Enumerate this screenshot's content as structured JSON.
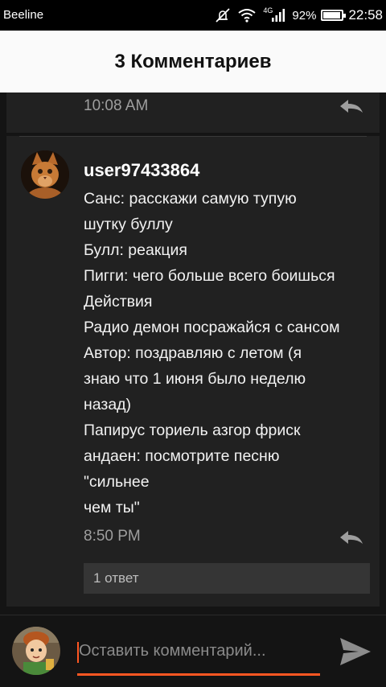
{
  "status_bar": {
    "carrier": "Beeline",
    "network": "4G",
    "battery": "92%",
    "battery_level": 0.92,
    "time": "22:58"
  },
  "header": {
    "title": "3 Комментариев"
  },
  "previous_comment": {
    "time": "10:08 AM"
  },
  "comment": {
    "username": "user97433864",
    "lines": [
      "Санс: расскажи самую тупую",
      "шутку буллу",
      "Булл: реакция",
      "Пигги: чего больше всего боишься",
      "Действия",
      "Радио демон посражайся с сансом",
      "Автор: поздравляю с летом (я",
      "знаю что 1 июня было неделю",
      "назад)",
      "Папирус ториель азгор фриск",
      "андаен: посмотрите песню",
      "\"сильнее",
      "чем ты\""
    ],
    "time": "8:50 PM",
    "replies_label": "1 ответ"
  },
  "input": {
    "placeholder": "Оставить комментарий..."
  },
  "colors": {
    "accent": "#ff5722",
    "background": "#141414",
    "card": "#212121"
  }
}
